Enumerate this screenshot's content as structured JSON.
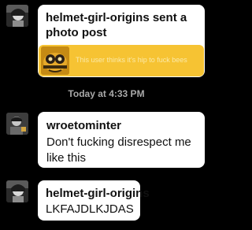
{
  "messages": [
    {
      "sender": "helmet-girl-origins",
      "text": "helmet-girl-origins sent a photo post",
      "post_caption": "This user thinks it's hip to fuck bees"
    },
    {
      "sender": "wroetominter",
      "text": "Don't fucking disrespect me like this"
    },
    {
      "sender": "helmet-girl-origins",
      "text": "LKFAJDLKJDAS"
    }
  ],
  "timestamp": "Today at 4:33 PM",
  "colors": {
    "background": "#000000",
    "bubble": "#ffffff",
    "post_card": "#f6c333",
    "timestamp": "#a9a9a9"
  },
  "icons": [
    "avatar-helmet-girl-origins",
    "avatar-wroetominter",
    "bee-thumbnail"
  ]
}
